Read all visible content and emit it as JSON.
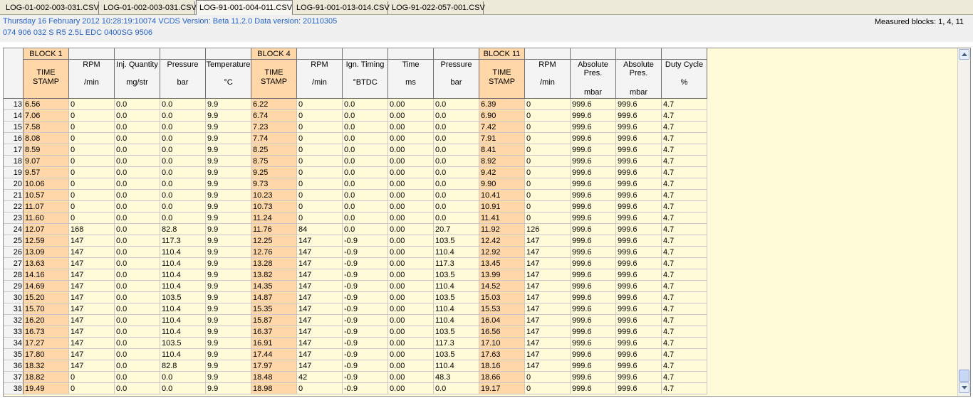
{
  "tabs": [
    {
      "label": "LOG-01-002-003-031.CSV",
      "active": false
    },
    {
      "label": "LOG-01-002-003-031.CSV",
      "active": false
    },
    {
      "label": "LOG-91-001-004-011.CSV",
      "active": true
    },
    {
      "label": "LOG-91-001-013-014.CSV",
      "active": false
    },
    {
      "label": "LOG-91-022-057-001.CSV",
      "active": false
    }
  ],
  "info": {
    "line1": "Thursday 16 February 2012 10:28:19:10074 VCDS Version: Beta 11.2.0 Data version: 20110305",
    "line2": "074 906 032 S  R5 2.5L EDC 0400SG  9506",
    "measured": "Measured blocks: 1, 4, 11"
  },
  "colors": {
    "timestamp": "#ffd7a8",
    "cell": "#fffbd8",
    "info_text": "#2563c9"
  },
  "grid": {
    "blocks": [
      {
        "label": "BLOCK 1",
        "col": 0
      },
      {
        "label": "BLOCK 4",
        "col": 5
      },
      {
        "label": "BLOCK 11",
        "col": 10
      }
    ],
    "columns": [
      {
        "title": [
          "TIME",
          "STAMP"
        ],
        "unit": "",
        "ts": true
      },
      {
        "title": [
          "RPM"
        ],
        "unit": "/min"
      },
      {
        "title": [
          "Inj. Quantity"
        ],
        "unit": "mg/str"
      },
      {
        "title": [
          "Pressure"
        ],
        "unit": "bar"
      },
      {
        "title": [
          "Temperature"
        ],
        "unit": "°C"
      },
      {
        "title": [
          "TIME",
          "STAMP"
        ],
        "unit": "",
        "ts": true
      },
      {
        "title": [
          "RPM"
        ],
        "unit": "/min"
      },
      {
        "title": [
          "Ign. Timing"
        ],
        "unit": "°BTDC"
      },
      {
        "title": [
          "Time"
        ],
        "unit": "ms"
      },
      {
        "title": [
          "Pressure"
        ],
        "unit": "bar"
      },
      {
        "title": [
          "TIME",
          "STAMP"
        ],
        "unit": "",
        "ts": true
      },
      {
        "title": [
          "RPM"
        ],
        "unit": "/min"
      },
      {
        "title": [
          "Absolute",
          "Pres."
        ],
        "unit": "mbar"
      },
      {
        "title": [
          "Absolute",
          "Pres."
        ],
        "unit": "mbar"
      },
      {
        "title": [
          "Duty Cycle"
        ],
        "unit": "%"
      }
    ],
    "rows": [
      {
        "n": "13",
        "v": [
          "6.56",
          "0",
          "0.0",
          "0.0",
          "9.9",
          "6.22",
          "0",
          "0.0",
          "0.00",
          "0.0",
          "6.39",
          "0",
          "999.6",
          "999.6",
          "4.7"
        ]
      },
      {
        "n": "14",
        "v": [
          "7.06",
          "0",
          "0.0",
          "0.0",
          "9.9",
          "6.74",
          "0",
          "0.0",
          "0.00",
          "0.0",
          "6.90",
          "0",
          "999.6",
          "999.6",
          "4.7"
        ]
      },
      {
        "n": "15",
        "v": [
          "7.58",
          "0",
          "0.0",
          "0.0",
          "9.9",
          "7.23",
          "0",
          "0.0",
          "0.00",
          "0.0",
          "7.42",
          "0",
          "999.6",
          "999.6",
          "4.7"
        ]
      },
      {
        "n": "16",
        "v": [
          "8.08",
          "0",
          "0.0",
          "0.0",
          "9.9",
          "7.74",
          "0",
          "0.0",
          "0.00",
          "0.0",
          "7.91",
          "0",
          "999.6",
          "999.6",
          "4.7"
        ]
      },
      {
        "n": "17",
        "v": [
          "8.59",
          "0",
          "0.0",
          "0.0",
          "9.9",
          "8.25",
          "0",
          "0.0",
          "0.00",
          "0.0",
          "8.41",
          "0",
          "999.6",
          "999.6",
          "4.7"
        ]
      },
      {
        "n": "18",
        "v": [
          "9.07",
          "0",
          "0.0",
          "0.0",
          "9.9",
          "8.75",
          "0",
          "0.0",
          "0.00",
          "0.0",
          "8.92",
          "0",
          "999.6",
          "999.6",
          "4.7"
        ]
      },
      {
        "n": "19",
        "v": [
          "9.57",
          "0",
          "0.0",
          "0.0",
          "9.9",
          "9.25",
          "0",
          "0.0",
          "0.00",
          "0.0",
          "9.42",
          "0",
          "999.6",
          "999.6",
          "4.7"
        ]
      },
      {
        "n": "20",
        "v": [
          "10.06",
          "0",
          "0.0",
          "0.0",
          "9.9",
          "9.73",
          "0",
          "0.0",
          "0.00",
          "0.0",
          "9.90",
          "0",
          "999.6",
          "999.6",
          "4.7"
        ]
      },
      {
        "n": "21",
        "v": [
          "10.57",
          "0",
          "0.0",
          "0.0",
          "9.9",
          "10.23",
          "0",
          "0.0",
          "0.00",
          "0.0",
          "10.41",
          "0",
          "999.6",
          "999.6",
          "4.7"
        ]
      },
      {
        "n": "22",
        "v": [
          "11.07",
          "0",
          "0.0",
          "0.0",
          "9.9",
          "10.73",
          "0",
          "0.0",
          "0.00",
          "0.0",
          "10.91",
          "0",
          "999.6",
          "999.6",
          "4.7"
        ]
      },
      {
        "n": "23",
        "v": [
          "11.60",
          "0",
          "0.0",
          "0.0",
          "9.9",
          "11.24",
          "0",
          "0.0",
          "0.00",
          "0.0",
          "11.41",
          "0",
          "999.6",
          "999.6",
          "4.7"
        ]
      },
      {
        "n": "24",
        "v": [
          "12.07",
          "168",
          "0.0",
          "82.8",
          "9.9",
          "11.76",
          "84",
          "0.0",
          "0.00",
          "20.7",
          "11.92",
          "126",
          "999.6",
          "999.6",
          "4.7"
        ]
      },
      {
        "n": "25",
        "v": [
          "12.59",
          "147",
          "0.0",
          "117.3",
          "9.9",
          "12.25",
          "147",
          "-0.9",
          "0.00",
          "103.5",
          "12.42",
          "147",
          "999.6",
          "999.6",
          "4.7"
        ]
      },
      {
        "n": "26",
        "v": [
          "13.09",
          "147",
          "0.0",
          "110.4",
          "9.9",
          "12.76",
          "147",
          "-0.9",
          "0.00",
          "110.4",
          "12.92",
          "147",
          "999.6",
          "999.6",
          "4.7"
        ]
      },
      {
        "n": "27",
        "v": [
          "13.63",
          "147",
          "0.0",
          "110.4",
          "9.9",
          "13.28",
          "147",
          "-0.9",
          "0.00",
          "117.3",
          "13.45",
          "147",
          "999.6",
          "999.6",
          "4.7"
        ]
      },
      {
        "n": "28",
        "v": [
          "14.16",
          "147",
          "0.0",
          "110.4",
          "9.9",
          "13.82",
          "147",
          "-0.9",
          "0.00",
          "103.5",
          "13.99",
          "147",
          "999.6",
          "999.6",
          "4.7"
        ]
      },
      {
        "n": "29",
        "v": [
          "14.69",
          "147",
          "0.0",
          "110.4",
          "9.9",
          "14.35",
          "147",
          "-0.9",
          "0.00",
          "110.4",
          "14.52",
          "147",
          "999.6",
          "999.6",
          "4.7"
        ]
      },
      {
        "n": "30",
        "v": [
          "15.20",
          "147",
          "0.0",
          "103.5",
          "9.9",
          "14.87",
          "147",
          "-0.9",
          "0.00",
          "103.5",
          "15.03",
          "147",
          "999.6",
          "999.6",
          "4.7"
        ]
      },
      {
        "n": "31",
        "v": [
          "15.70",
          "147",
          "0.0",
          "110.4",
          "9.9",
          "15.35",
          "147",
          "-0.9",
          "0.00",
          "110.4",
          "15.53",
          "147",
          "999.6",
          "999.6",
          "4.7"
        ]
      },
      {
        "n": "32",
        "v": [
          "16.20",
          "147",
          "0.0",
          "110.4",
          "9.9",
          "15.87",
          "147",
          "-0.9",
          "0.00",
          "110.4",
          "16.04",
          "147",
          "999.6",
          "999.6",
          "4.7"
        ]
      },
      {
        "n": "33",
        "v": [
          "16.73",
          "147",
          "0.0",
          "110.4",
          "9.9",
          "16.37",
          "147",
          "-0.9",
          "0.00",
          "103.5",
          "16.56",
          "147",
          "999.6",
          "999.6",
          "4.7"
        ]
      },
      {
        "n": "34",
        "v": [
          "17.27",
          "147",
          "0.0",
          "103.5",
          "9.9",
          "16.91",
          "147",
          "-0.9",
          "0.00",
          "117.3",
          "17.10",
          "147",
          "999.6",
          "999.6",
          "4.7"
        ]
      },
      {
        "n": "35",
        "v": [
          "17.80",
          "147",
          "0.0",
          "110.4",
          "9.9",
          "17.44",
          "147",
          "-0.9",
          "0.00",
          "103.5",
          "17.63",
          "147",
          "999.6",
          "999.6",
          "4.7"
        ]
      },
      {
        "n": "36",
        "v": [
          "18.32",
          "147",
          "0.0",
          "82.8",
          "9.9",
          "17.97",
          "147",
          "-0.9",
          "0.00",
          "110.4",
          "18.16",
          "147",
          "999.6",
          "999.6",
          "4.7"
        ]
      },
      {
        "n": "37",
        "v": [
          "18.82",
          "0",
          "0.0",
          "0.0",
          "9.9",
          "18.48",
          "42",
          "-0.9",
          "0.00",
          "48.3",
          "18.66",
          "0",
          "999.6",
          "999.6",
          "4.7"
        ]
      },
      {
        "n": "38",
        "v": [
          "19.49",
          "0",
          "0.0",
          "0.0",
          "9.9",
          "18.98",
          "0",
          "-0.9",
          "0.00",
          "0.0",
          "19.17",
          "0",
          "999.6",
          "999.6",
          "4.7"
        ]
      }
    ]
  }
}
